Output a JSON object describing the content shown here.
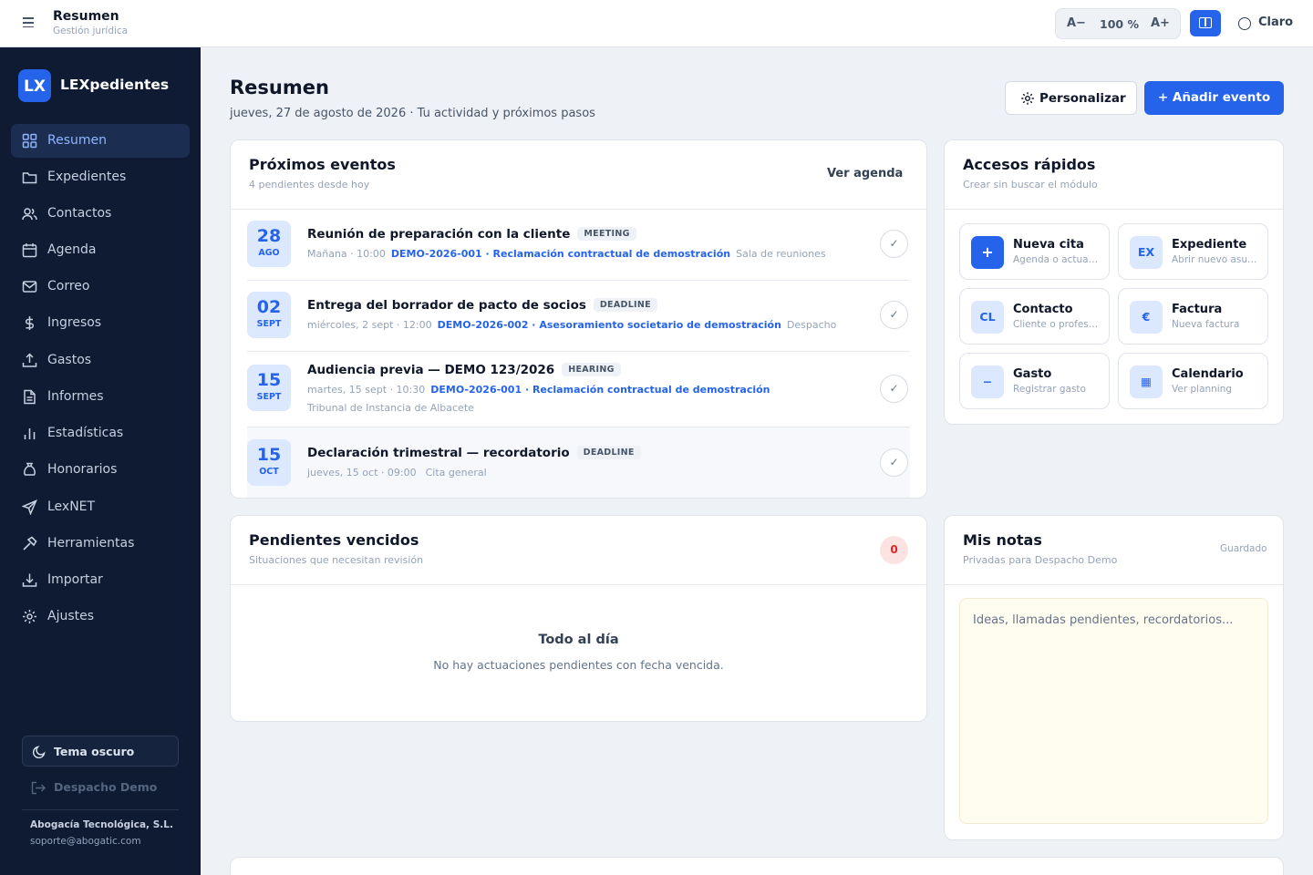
{
  "topbar": {
    "title": "Resumen",
    "subtitle": "Gestión jurídica",
    "zoom_decrease": "A−",
    "zoom_value": "100 %",
    "zoom_increase": "A+",
    "theme_label": "Claro"
  },
  "sidebar": {
    "logo": "LX",
    "brand": "LEXpedientes",
    "items": [
      {
        "label": "Resumen",
        "icon": "grid-icon",
        "active": true
      },
      {
        "label": "Expedientes",
        "icon": "folder-icon"
      },
      {
        "label": "Contactos",
        "icon": "users-icon"
      },
      {
        "label": "Agenda",
        "icon": "calendar-icon"
      },
      {
        "label": "Correo",
        "icon": "mail-icon"
      },
      {
        "label": "Ingresos",
        "icon": "dollar-icon"
      },
      {
        "label": "Gastos",
        "icon": "upload-icon"
      },
      {
        "label": "Informes",
        "icon": "document-icon"
      },
      {
        "label": "Estadísticas",
        "icon": "bar-chart-icon"
      },
      {
        "label": "Honorarios",
        "icon": "bag-icon"
      },
      {
        "label": "LexNET",
        "icon": "send-icon"
      },
      {
        "label": "Herramientas",
        "icon": "hammer-icon"
      },
      {
        "label": "Importar",
        "icon": "download-icon"
      },
      {
        "label": "Ajustes",
        "icon": "gear-icon"
      }
    ],
    "dark_theme_label": "Tema oscuro",
    "logout_label": "Despacho Demo",
    "company": "Abogacía Tecnológica, S.L.",
    "support_email": "soporte@abogatic.com"
  },
  "header": {
    "title": "Resumen",
    "subtitle": "jueves, 27 de agosto de 2026 · Tu actividad y próximos pasos",
    "customize_label": "Personalizar",
    "add_event_label": "+ Añadir evento"
  },
  "events": {
    "title": "Próximos eventos",
    "subtitle": "4 pendientes desde hoy",
    "link_label": "Ver agenda",
    "items": [
      {
        "day": "28",
        "month": "AGO",
        "title": "Reunión de preparación con la cliente",
        "tag": "MEETING",
        "when": "Mañana · 10:00",
        "ref": "DEMO-2026-001 · Reclamación contractual de demostración",
        "place": "Sala de reuniones",
        "extra": ""
      },
      {
        "day": "02",
        "month": "SEPT",
        "title": "Entrega del borrador de pacto de socios",
        "tag": "DEADLINE",
        "when": "miércoles, 2 sept · 12:00",
        "ref": "DEMO-2026-002 · Asesoramiento societario de demostración",
        "place": "Despacho",
        "extra": ""
      },
      {
        "day": "15",
        "month": "SEPT",
        "title": "Audiencia previa — DEMO 123/2026",
        "tag": "HEARING",
        "when": "martes, 15 sept · 10:30",
        "ref": "DEMO-2026-001 · Reclamación contractual de demostración",
        "place": "",
        "extra": "Tribunal de Instancia de Albacete"
      },
      {
        "day": "15",
        "month": "OCT",
        "title": "Declaración trimestral — recordatorio",
        "tag": "DEADLINE",
        "when": "jueves, 15 oct · 09:00",
        "ref": "",
        "place": "Cita general",
        "extra": ""
      }
    ],
    "check_glyph": "✓"
  },
  "quick": {
    "title": "Accesos rápidos",
    "subtitle": "Crear sin buscar el módulo",
    "items": [
      {
        "icon": "+",
        "title": "Nueva cita",
        "sub": "Agenda o actuación"
      },
      {
        "icon": "EX",
        "title": "Expediente",
        "sub": "Abrir nuevo asunto"
      },
      {
        "icon": "CL",
        "title": "Contacto",
        "sub": "Cliente o profesional"
      },
      {
        "icon": "€",
        "title": "Factura",
        "sub": "Nueva factura"
      },
      {
        "icon": "−",
        "title": "Gasto",
        "sub": "Registrar gasto"
      },
      {
        "icon": "▦",
        "title": "Calendario",
        "sub": "Ver planning"
      }
    ]
  },
  "overdue": {
    "title": "Pendientes vencidos",
    "subtitle": "Situaciones que necesitan revisión",
    "count": "0",
    "empty_title": "Todo al día",
    "empty_sub": "No hay actuaciones pendientes con fecha vencida."
  },
  "notes": {
    "title": "Mis notas",
    "subtitle": "Privadas para Despacho Demo",
    "status": "Guardado",
    "placeholder": "Ideas, llamadas pendientes, recordatorios..."
  },
  "colors": {
    "accent": "#2563eb",
    "sidebar_bg": "#0f1b33",
    "danger": "#dc2626"
  }
}
